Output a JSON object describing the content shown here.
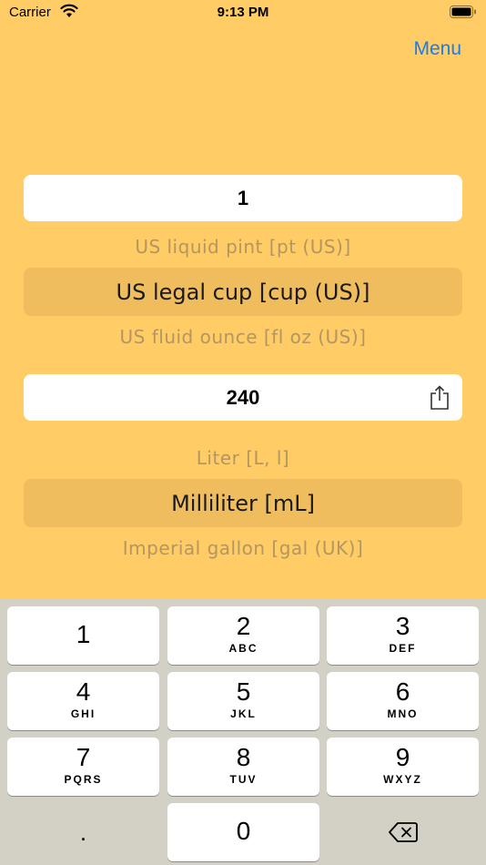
{
  "status_bar": {
    "carrier": "Carrier",
    "time": "9:13 PM"
  },
  "header": {
    "menu_label": "Menu"
  },
  "top_converter": {
    "value": "1",
    "units_above": "US liquid pint [pt (US)]",
    "unit_selected": "US legal cup [cup (US)]",
    "units_below": "US fluid ounce [fl oz (US)]"
  },
  "bottom_converter": {
    "value": "240",
    "units_above": "Liter [L, l]",
    "unit_selected": "Milliliter [mL]",
    "units_below": "Imperial gallon [gal (UK)]"
  },
  "keyboard": {
    "keys": [
      {
        "num": "1",
        "letters": ""
      },
      {
        "num": "2",
        "letters": "ABC"
      },
      {
        "num": "3",
        "letters": "DEF"
      },
      {
        "num": "4",
        "letters": "GHI"
      },
      {
        "num": "5",
        "letters": "JKL"
      },
      {
        "num": "6",
        "letters": "MNO"
      },
      {
        "num": "7",
        "letters": "PQRS"
      },
      {
        "num": "8",
        "letters": "TUV"
      },
      {
        "num": "9",
        "letters": "WXYZ"
      },
      {
        "num": "0",
        "letters": ""
      }
    ],
    "decimal_label": "."
  },
  "colors": {
    "background": "#FFCC66",
    "picker_selected": "#EFBD5E",
    "picker_faded_text": "#B39660",
    "accent": "#1A7CF0",
    "keyboard_bg": "#D3D0C6"
  },
  "icons": [
    "wifi-icon",
    "battery-icon",
    "share-icon",
    "backspace-icon"
  ]
}
